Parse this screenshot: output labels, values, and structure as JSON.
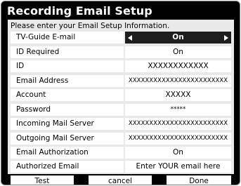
{
  "title": "Recording Email Setup",
  "instruction": "Please enter your Email Setup Information.",
  "rows": [
    {
      "label": "TV-Guide E-mail",
      "value": "On"
    },
    {
      "label": "ID Required",
      "value": "On"
    },
    {
      "label": "ID",
      "value": "XXXXXXXXXXXX"
    },
    {
      "label": "Email Address",
      "value": "XXXXXXXXXXXXXXXXXXXXXXXX"
    },
    {
      "label": "Account",
      "value": "XXXXX"
    },
    {
      "label": "Password",
      "value": "*****"
    },
    {
      "label": "Incoming Mail Server",
      "value": "XXXXXXXXXXXXXXXXXXXXXXXX"
    },
    {
      "label": "Outgoing Mail Server",
      "value": "XXXXXXXXXXXXXXXXXXXXXXXX"
    },
    {
      "label": "Email Authorization",
      "value": "On"
    },
    {
      "label": "Authorized Email",
      "value": "Enter YOUR email here"
    }
  ],
  "buttons": {
    "test": "Test",
    "cancel": "cancel",
    "done": "Done"
  },
  "colors": {
    "frame": "#000000",
    "content_bg": "#e9e9e9",
    "field_bg": "#ffffff",
    "selected_bg": "#1e1e1e"
  },
  "icons": {
    "left": "arrow-left-icon",
    "right": "arrow-right-icon"
  }
}
